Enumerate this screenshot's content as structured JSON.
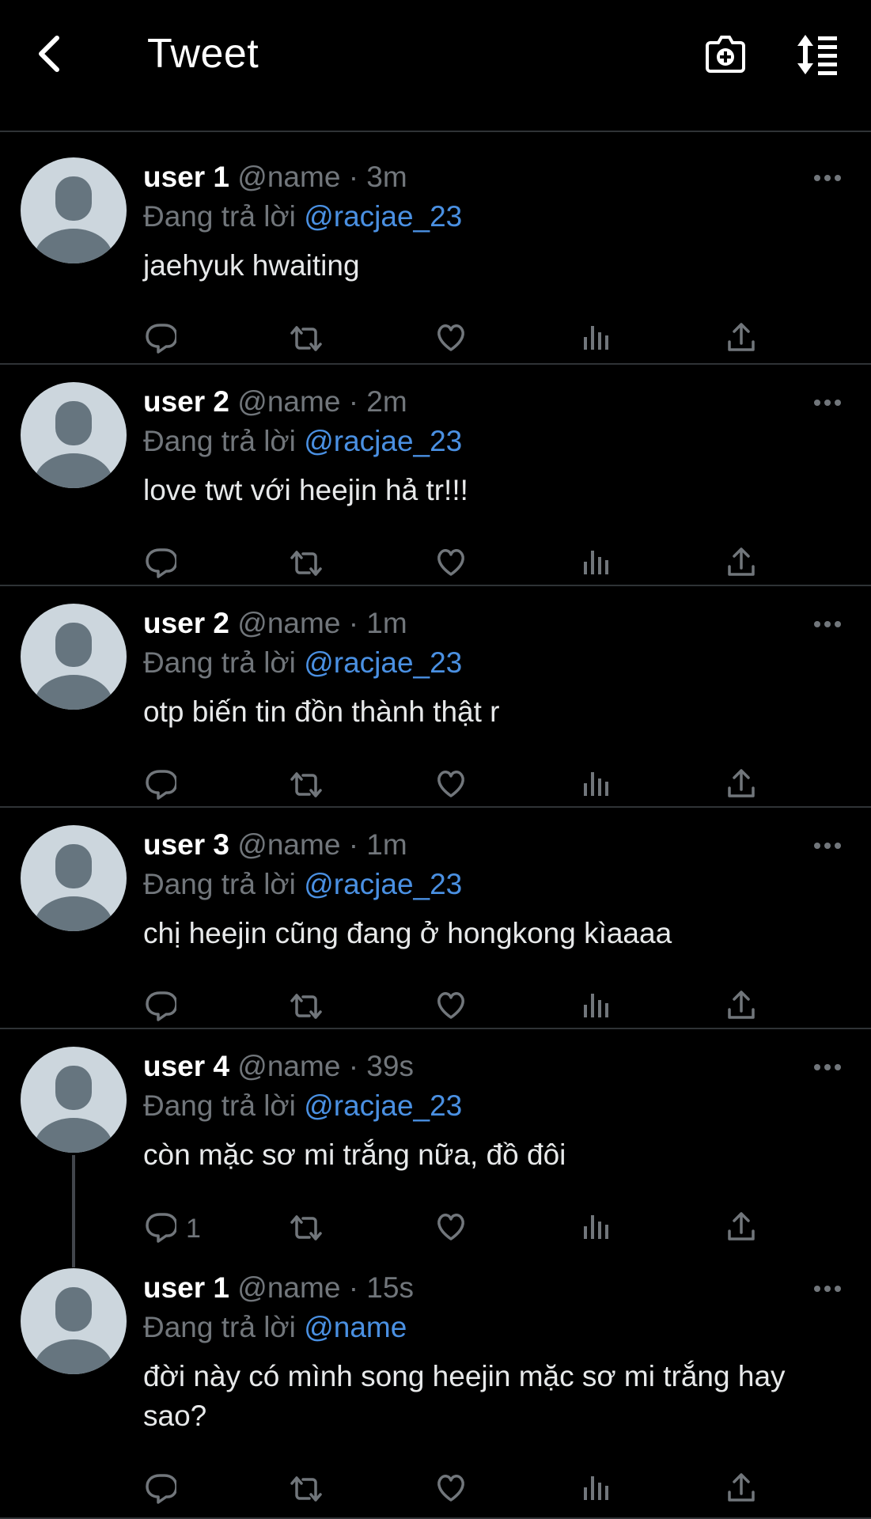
{
  "header": {
    "title": "Tweet"
  },
  "icons": {
    "back": "back-arrow-icon",
    "camera": "camera-add-icon",
    "sort": "sort-icon"
  },
  "colors": {
    "background": "#000000",
    "mention": "#4a90e2",
    "muted": "#71767b"
  },
  "tweets": [
    {
      "user": "user 1",
      "handle": "@name",
      "time": "· 3m",
      "reply_prefix": "Đang trả lời",
      "reply_to": "@racjae_23",
      "text": "jaehyuk hwaiting",
      "reply_count": ""
    },
    {
      "user": "user 2",
      "handle": "@name",
      "time": "· 2m",
      "reply_prefix": "Đang trả lời",
      "reply_to": "@racjae_23",
      "text": "love twt với heejin hả tr!!!",
      "reply_count": ""
    },
    {
      "user": "user 2",
      "handle": "@name",
      "time": "· 1m",
      "reply_prefix": "Đang trả lời",
      "reply_to": "@racjae_23",
      "text": "otp biến tin đồn thành thật r",
      "reply_count": ""
    },
    {
      "user": "user 3",
      "handle": "@name",
      "time": "· 1m",
      "reply_prefix": "Đang trả lời",
      "reply_to": "@racjae_23",
      "text": "chị heejin cũng đang ở hongkong kìaaaa",
      "reply_count": ""
    },
    {
      "user": "user 4",
      "handle": "@name",
      "time": "· 39s",
      "reply_prefix": "Đang trả lời",
      "reply_to": "@racjae_23",
      "text": "còn mặc sơ mi trắng nữa, đồ đôi",
      "reply_count": "1"
    },
    {
      "user": "user 1",
      "handle": "@name",
      "time": "· 15s",
      "reply_prefix": "Đang trả lời",
      "reply_to": "@name",
      "text": "đời này có mình song heejin mặc sơ mi trắng hay sao?",
      "reply_count": ""
    }
  ]
}
